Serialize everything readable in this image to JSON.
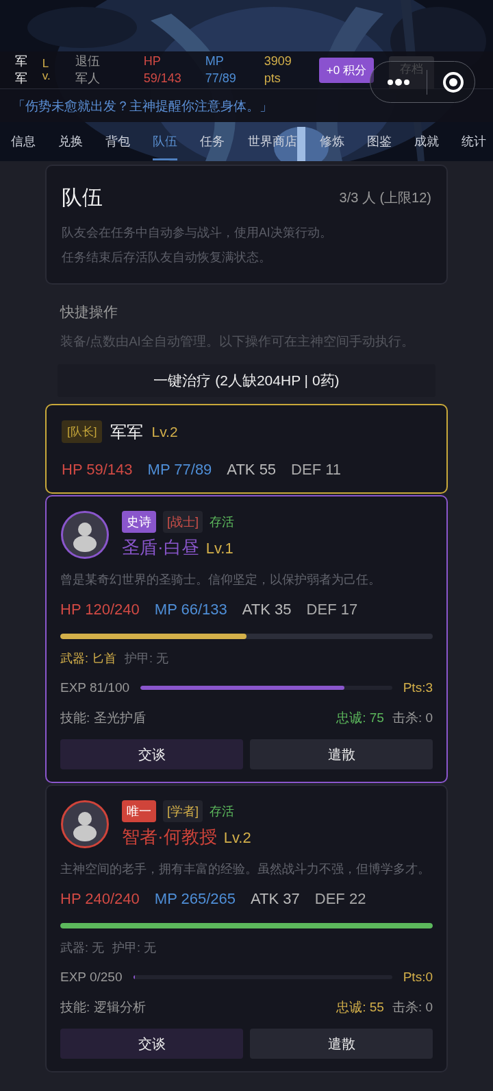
{
  "header": {
    "name": "军军",
    "lv": "Lv.",
    "title": "退伍军人",
    "hp": "HP 59/143",
    "mp": "MP 77/89",
    "points": "3909 pts",
    "points_button": "+0 积分",
    "save_button": "存档"
  },
  "notice": "「伤势未愈就出发？主神提醒你注意身体。」",
  "tabs": [
    {
      "label": "信息",
      "selected": false
    },
    {
      "label": "兑换",
      "selected": false
    },
    {
      "label": "背包",
      "selected": false
    },
    {
      "label": "队伍",
      "selected": true
    },
    {
      "label": "任务",
      "selected": false
    },
    {
      "label": "世界商店",
      "selected": false
    },
    {
      "label": "修炼",
      "selected": false
    },
    {
      "label": "图鉴",
      "selected": false
    },
    {
      "label": "成就",
      "selected": false
    },
    {
      "label": "统计",
      "selected": false
    }
  ],
  "team": {
    "title": "队伍",
    "count": "3/3 人 (上限12)",
    "lines": [
      "队友会在任务中自动参与战斗，使用AI决策行动。",
      "任务结束后存活队友自动恢复满状态。"
    ]
  },
  "quick_ops": {
    "title": "快捷操作",
    "description": "装备/点数由AI全自动管理。以下操作可在主神空间手动执行。",
    "heal_button": "一键治疗 (2人缺204HP | 0药)"
  },
  "leader": {
    "tag": "[队长]",
    "name": "军军",
    "lv": "Lv.2",
    "hp": "HP 59/143",
    "mp": "MP 77/89",
    "atk": "ATK 55",
    "def": "DEF 11"
  },
  "members": [
    {
      "rarity": "史诗",
      "color": "#8a56cc",
      "role": {
        "label": "[战士]",
        "color": "#d0504a"
      },
      "status": "存活",
      "name": "圣盾·白昼",
      "lv": "Lv.1",
      "selected": true,
      "bio": "曾是某奇幻世界的圣骑士。信仰坚定，以保护弱者为己任。",
      "hp": "HP 120/240",
      "mp": "MP 66/133",
      "atk": "ATK 35",
      "def": "DEF 17",
      "hp_bar": {
        "level": 0.5
      },
      "weapon": "武器: 匕首",
      "weapon_equipped": true,
      "armor": "护甲: 无",
      "exp": "EXP 81/100",
      "exp_bar": {
        "level": 0.81
      },
      "pts": "Pts:3",
      "skill": "技能: 圣光护盾",
      "loyalty": {
        "label": "忠诚: 75",
        "color": "#5cb85c"
      },
      "kills": "击杀: 0",
      "buttons": [
        "交谈",
        "遣散"
      ]
    },
    {
      "rarity": "唯一",
      "color": "#d0443a",
      "role": {
        "label": "[学者]",
        "color": "#d4b04a"
      },
      "status": "存活",
      "name": "智者·何教授",
      "lv": "Lv.2",
      "selected": false,
      "bio": "主神空间的老手，拥有丰富的经验。虽然战斗力不强，但博学多才。",
      "hp": "HP 240/240",
      "mp": "MP 265/265",
      "atk": "ATK 37",
      "def": "DEF 22",
      "hp_bar": {
        "level": 1
      },
      "weapon": "武器: 无",
      "weapon_equipped": false,
      "armor": "护甲: 无",
      "exp": "EXP 0/250",
      "exp_bar": {
        "level": 0
      },
      "pts": "Pts:0",
      "skill": "技能: 逻辑分析",
      "loyalty": {
        "label": "忠诚: 55",
        "color": "#d4b04a"
      },
      "kills": "击杀: 0",
      "buttons": [
        "交谈",
        "遣散"
      ]
    }
  ]
}
